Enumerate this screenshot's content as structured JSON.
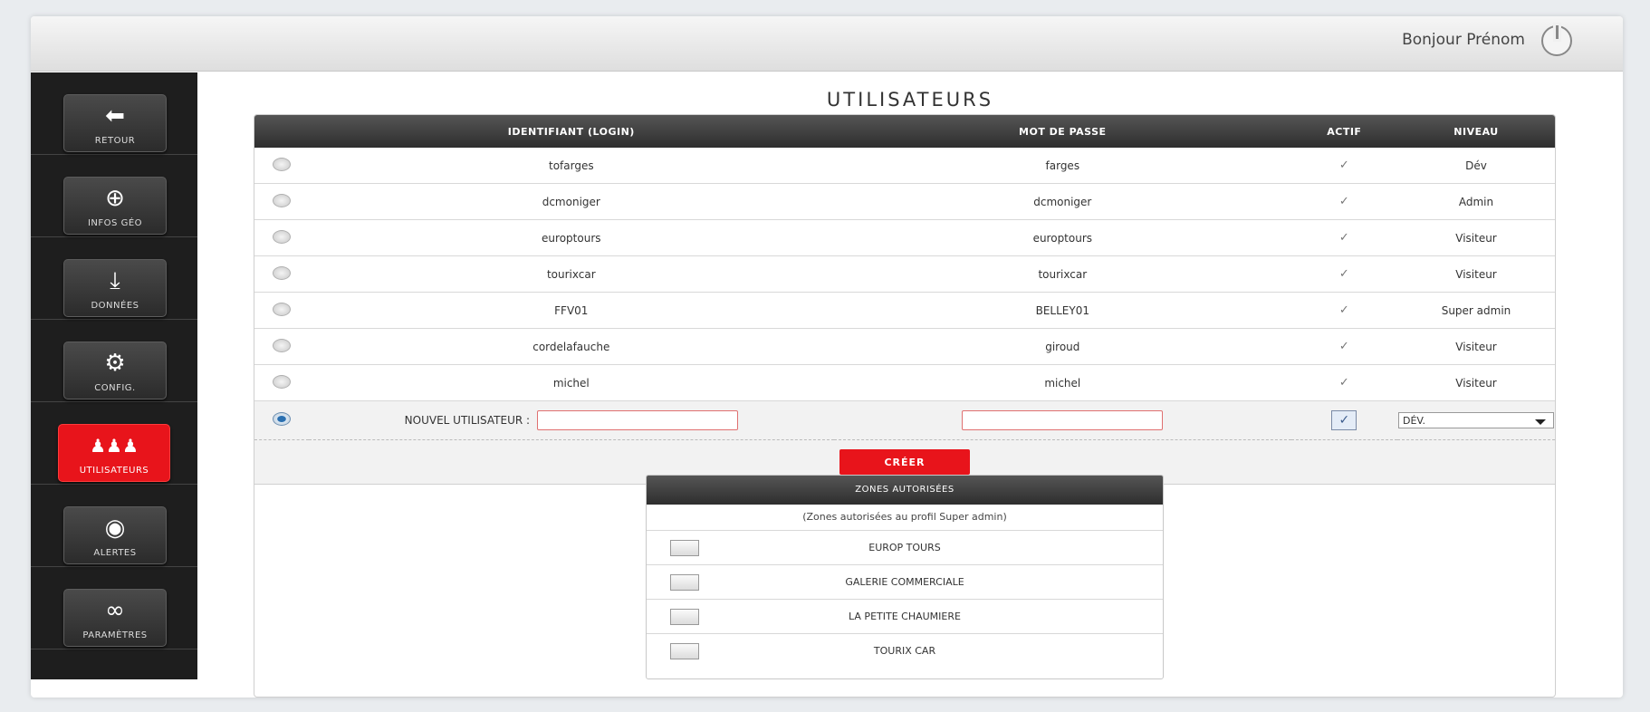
{
  "header": {
    "greeting": "Bonjour Prénom",
    "power_icon": "power-icon"
  },
  "sidebar": {
    "items": [
      {
        "label": "RETOUR",
        "icon": "back-arrow-icon",
        "glyph": "⬅",
        "active": false
      },
      {
        "label": "INFOS GÉO",
        "icon": "globe-icon",
        "glyph": "⊕",
        "active": false
      },
      {
        "label": "DONNÉES",
        "icon": "download-icon",
        "glyph": "⤓",
        "active": false
      },
      {
        "label": "CONFIG.",
        "icon": "gear-icon",
        "glyph": "⚙",
        "active": false
      },
      {
        "label": "UTILISATEURS",
        "icon": "users-icon",
        "glyph": "♟♟♟",
        "active": true
      },
      {
        "label": "ALERTES",
        "icon": "alert-broadcast-icon",
        "glyph": "◉",
        "active": false
      },
      {
        "label": "PARAMÈTRES",
        "icon": "link-icon",
        "glyph": "∞",
        "active": false
      }
    ]
  },
  "page": {
    "title": "UTILISATEURS"
  },
  "users_table": {
    "columns": [
      "IDENTIFIANT (LOGIN)",
      "MOT DE PASSE",
      "ACTIF",
      "NIVEAU"
    ],
    "rows": [
      {
        "login": "tofarges",
        "password": "farges",
        "actif": "✓",
        "niveau": "Dév"
      },
      {
        "login": "dcmoniger",
        "password": "dcmoniger",
        "actif": "✓",
        "niveau": "Admin"
      },
      {
        "login": "europtours",
        "password": "europtours",
        "actif": "✓",
        "niveau": "Visiteur"
      },
      {
        "login": "tourixcar",
        "password": "tourixcar",
        "actif": "✓",
        "niveau": "Visiteur"
      },
      {
        "login": "FFV01",
        "password": "BELLEY01",
        "actif": "✓",
        "niveau": "Super admin"
      },
      {
        "login": "cordelafauche",
        "password": "giroud",
        "actif": "✓",
        "niveau": "Visiteur"
      },
      {
        "login": "michel",
        "password": "michel",
        "actif": "✓",
        "niveau": "Visiteur"
      }
    ],
    "new_user": {
      "label": "NOUVEL UTILISATEUR :",
      "login_value": "",
      "password_value": "",
      "actif_checked": "✓",
      "niveau_selected": "DÉV."
    },
    "create_label": "CRÉER"
  },
  "zones": {
    "title": "ZONES AUTORISÉES",
    "note": "(Zones autorisées au profil Super admin)",
    "items": [
      "EUROP TOURS",
      "GALERIE COMMERCIALE",
      "LA PETITE CHAUMIERE",
      "TOURIX CAR"
    ]
  }
}
